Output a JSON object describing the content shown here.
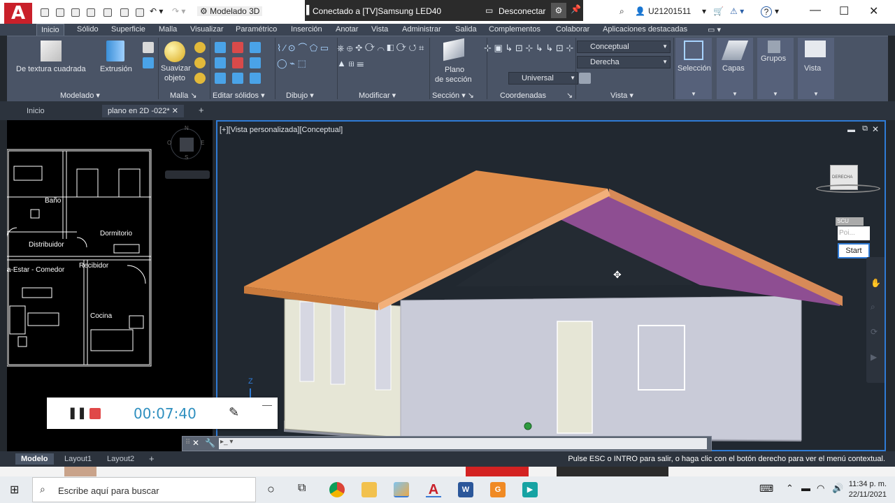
{
  "titlebar": {
    "workspace": "Modelado 3D",
    "remote_title": "Conectado a [TV]Samsung LED40",
    "disconnect": "Desconectar",
    "user": "U21201511",
    "help": "?"
  },
  "ribbon_tabs": [
    "Inicio",
    "Sólido",
    "Superficie",
    "Malla",
    "Visualizar",
    "Paramétrico",
    "Inserción",
    "Anotar",
    "Vista",
    "Administrar",
    "Salida",
    "Complementos",
    "Colaborar",
    "Aplicaciones destacadas"
  ],
  "ribbon": {
    "texture_cube": "De textura cuadrada",
    "extrusion": "Extrusión",
    "smooth1": "Suavizar",
    "smooth2": "objeto",
    "section_plane1": "Plano",
    "section_plane2": "de sección",
    "visual_style": "Conceptual",
    "view_side": "Derecha",
    "ucs": "Universal",
    "selection": "Selección",
    "layers": "Capas",
    "groups": "Grupos",
    "view": "Vista",
    "panels": {
      "modelado": "Modelado",
      "malla": "Malla",
      "editar_solidos": "Editar sólidos",
      "dibujo": "Dibujo",
      "modificar": "Modificar",
      "seccion": "Sección",
      "coordenadas": "Coordenadas",
      "vista": "Vista"
    }
  },
  "doc_tabs": {
    "home": "Inicio",
    "drawing": "plano en 2D -022*",
    "add": "+"
  },
  "left_viewport": {
    "compass": {
      "n": "N",
      "e": "E",
      "s": "S",
      "o": "O"
    },
    "rooms": {
      "bano": "Baño",
      "dormitorio": "Dormitorio",
      "distribuidor": "Distribuidor",
      "recibidor": "Recibidor",
      "estar": "a-Estar - Comedor",
      "cocina": "Cocina"
    }
  },
  "main_viewport": {
    "label": "[+][Vista personalizada][Conceptual]",
    "viewcube": "DERECHA",
    "scu": "SCU",
    "poi": "Poi...",
    "start": "Start",
    "axis_z": "Z"
  },
  "recorder": {
    "time": "00:07:40"
  },
  "layout_tabs": {
    "model": "Modelo",
    "layout1": "Layout1",
    "layout2": "Layout2",
    "add": "+"
  },
  "status_msg": "Pulse ESC o INTRO para salir, o haga clic con el botón derecho para ver el menú contextual.",
  "taskbar": {
    "search_placeholder": "Escribe aquí para buscar",
    "time": "11:34 p. m.",
    "date": "22/11/2021"
  },
  "colors": {
    "roof_orange": "#e08d4a",
    "roof_purple": "#8e4e92",
    "wall": "#c9cbd8",
    "viewport_bg": "#212830",
    "accent_blue": "#2f7bd6"
  }
}
